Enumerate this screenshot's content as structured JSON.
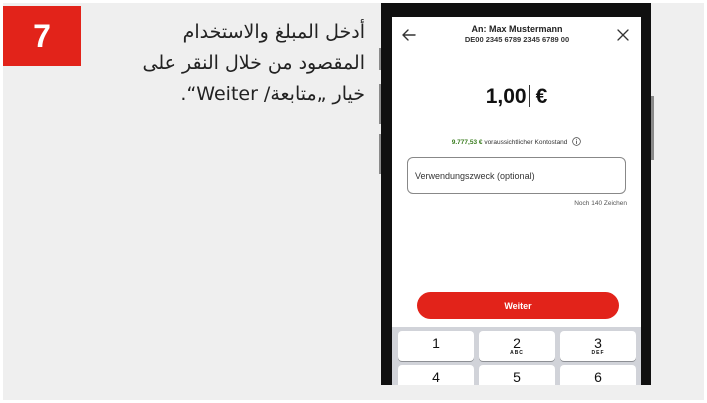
{
  "step": {
    "number": "7",
    "instruction_lines": [
      "أدخل المبلغ والاستخدام",
      "المقصود من خلال النقر على",
      "خيار „متابعة/ Weiter“."
    ]
  },
  "phone": {
    "header": {
      "recipient": "An: Max Mustermann",
      "iban": "DE00 2345 6789 2345 6789 00",
      "back_icon": "arrow-left-icon",
      "close_icon": "close-icon"
    },
    "amount": {
      "value": "1,00",
      "currency": "€"
    },
    "balance": {
      "value": "9.777,53 €",
      "label": "voraussichtlicher Kontostand",
      "icon": "info-icon"
    },
    "purpose_field": {
      "placeholder": "Verwendungszweck (optional)",
      "char_counter": "Noch 140 Zeichen"
    },
    "submit_label": "Weiter",
    "keypad": [
      {
        "digit": "1",
        "letters": ""
      },
      {
        "digit": "2",
        "letters": "ABC"
      },
      {
        "digit": "3",
        "letters": "DEF"
      },
      {
        "digit": "4",
        "letters": ""
      },
      {
        "digit": "5",
        "letters": ""
      },
      {
        "digit": "6",
        "letters": ""
      }
    ]
  },
  "colors": {
    "accent_red": "#e2231a",
    "balance_green": "#3a7d1f",
    "panel_bg": "#efefef"
  }
}
